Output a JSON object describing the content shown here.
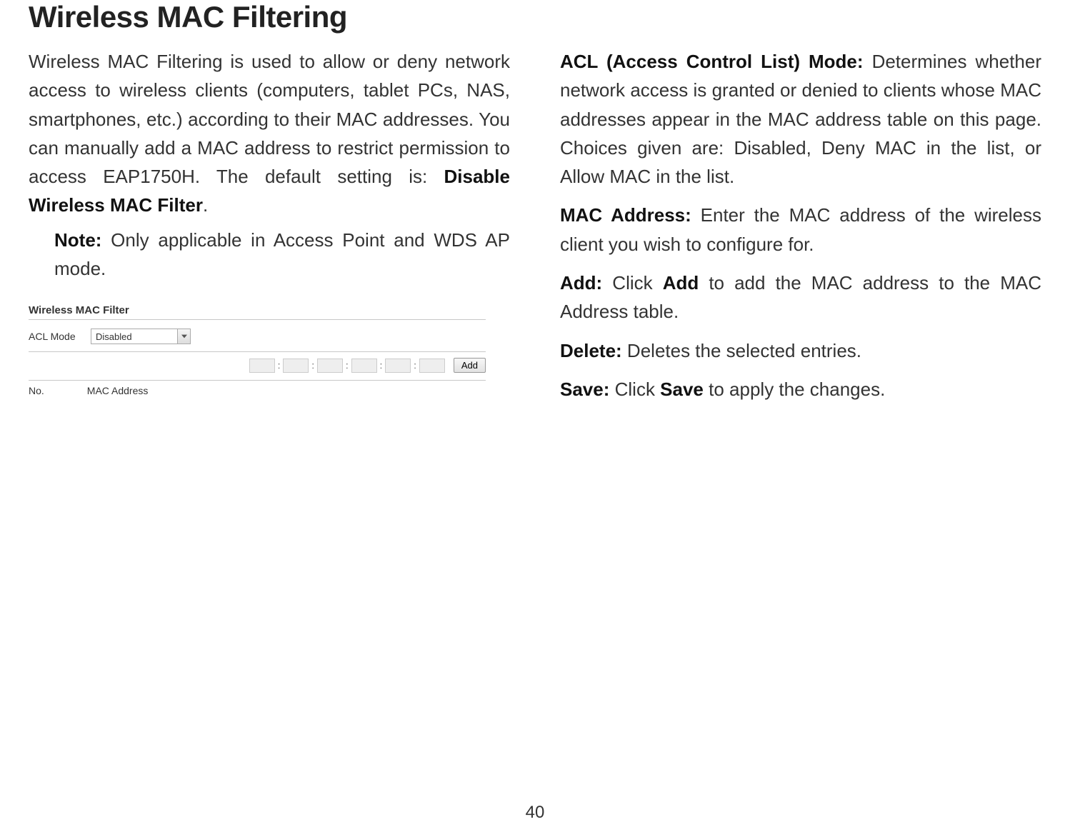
{
  "title": "Wireless MAC Filtering",
  "left": {
    "intro_part1": "Wireless MAC Filtering is used to allow or deny network access to wireless clients (computers, tablet PCs, NAS, smartphones, etc.) according to their MAC addresses. You can manually add a MAC address to restrict permission to access EAP1750H. The default setting is: ",
    "intro_bold": "Disable Wireless MAC Filter",
    "intro_end": ".",
    "note_label": "Note:",
    "note_text": "  Only applicable in Access Point and WDS AP mode."
  },
  "screenshot": {
    "title": "Wireless MAC Filter",
    "acl_label": "ACL Mode",
    "acl_value": "Disabled",
    "add_button": "Add",
    "col_no": "No.",
    "col_mac": "MAC Address"
  },
  "right": {
    "acl_label": "ACL (Access Control List) Mode:",
    "acl_text": " Determines whether network access is granted or denied to clients whose MAC addresses appear in the MAC address table on this page. Choices given are: Disabled, Deny MAC in the list, or Allow MAC in the list.",
    "mac_label": "MAC Address:",
    "mac_text": " Enter the MAC address of the wireless client you wish to configure for.",
    "add_label": "Add:",
    "add_text_pre": " Click ",
    "add_bold": "Add",
    "add_text_post": " to add the MAC address to the MAC Address table.",
    "delete_label": "Delete:",
    "delete_text": " Deletes the selected entries.",
    "save_label": "Save:",
    "save_text_pre": " Click ",
    "save_bold": "Save",
    "save_text_post": " to apply the changes."
  },
  "page_number": "40"
}
